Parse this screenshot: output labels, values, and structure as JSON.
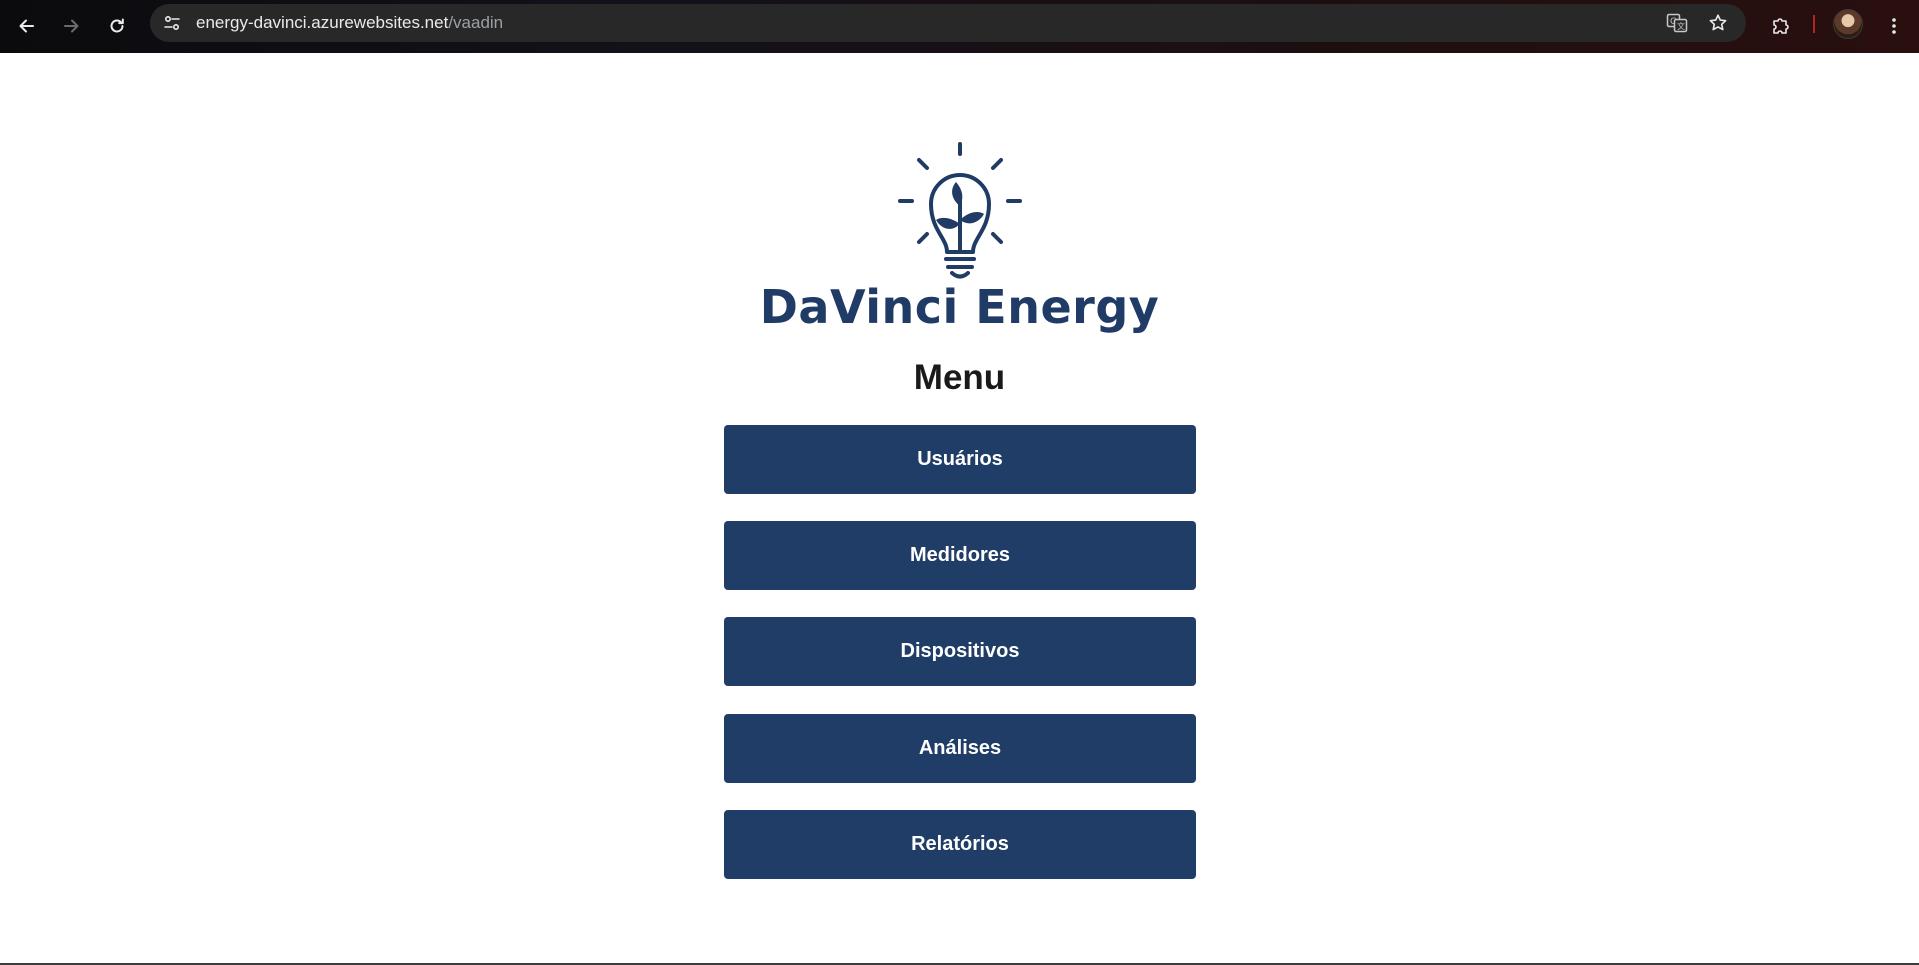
{
  "browser": {
    "url_host": "energy-davinci.azurewebsites.net",
    "url_path": "/vaadin",
    "icons": [
      "back-icon",
      "forward-icon",
      "reload-icon",
      "site-info-icon",
      "translate-icon",
      "bookmark-star-icon",
      "extensions-icon",
      "profile-avatar",
      "more-menu-icon"
    ]
  },
  "brand": {
    "name": "DaVinci Energy",
    "logo_icon": "lightbulb-plant-icon",
    "color": "#1f3b66"
  },
  "menu": {
    "title": "Menu",
    "items": [
      {
        "label": "Usuários"
      },
      {
        "label": "Medidores"
      },
      {
        "label": "Dispositivos"
      },
      {
        "label": "Análises"
      },
      {
        "label": "Relatórios"
      }
    ],
    "button_color": "#1f3d66"
  }
}
